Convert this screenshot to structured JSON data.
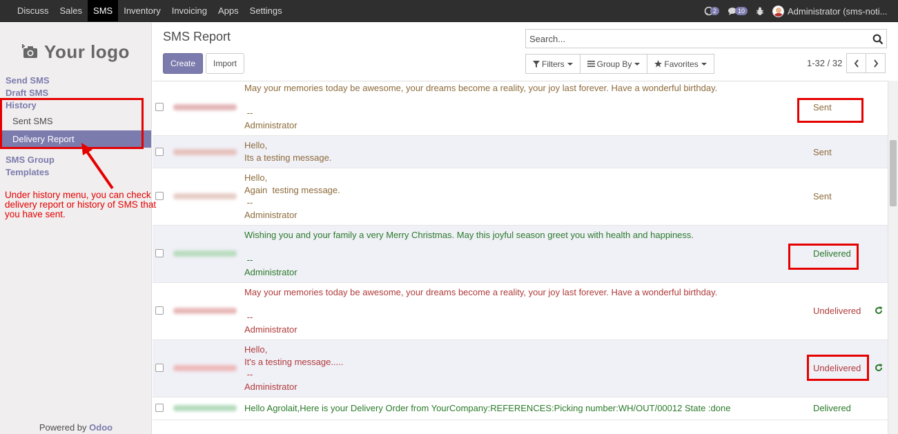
{
  "topbar": {
    "menu": [
      "Discuss",
      "Sales",
      "SMS",
      "Inventory",
      "Invoicing",
      "Apps",
      "Settings"
    ],
    "active_menu": "SMS",
    "chat_count": "2",
    "activity_count": "10",
    "user_label": "Administrator (sms-noti..."
  },
  "sidebar": {
    "logo_text": "Your logo",
    "send_sms": "Send SMS",
    "draft_sms": "Draft SMS",
    "history": "History",
    "sent_sms": "Sent SMS",
    "delivery_report": "Delivery Report",
    "sms_group": "SMS Group",
    "templates": "Templates",
    "annotation": "Under history menu, you can check delivery report or history of SMS that you have sent.",
    "powered_prefix": "Powered by ",
    "powered_brand": "Odoo"
  },
  "control_panel": {
    "title": "SMS Report",
    "create_label": "Create",
    "import_label": "Import",
    "search_placeholder": "Search...",
    "filters_label": "Filters",
    "groupby_label": "Group By",
    "favorites_label": "Favorites",
    "pager": "1-32 / 32"
  },
  "rows": [
    {
      "message": "May your memories today be awesome, your dreams become a reality, your joy last forever. Have a wonderful birthday.\n\n --\nAdministrator",
      "status": "Sent"
    },
    {
      "message": "Hello,\nIts a testing message.",
      "status": "Sent"
    },
    {
      "message": "Hello,\nAgain  testing message.\n --\nAdministrator",
      "status": "Sent"
    },
    {
      "message": "Wishing you and your family a very Merry Christmas. May this joyful season greet you with health and happiness.\n\n --\nAdministrator",
      "status": "Delivered"
    },
    {
      "message": "May your memories today be awesome, your dreams become a reality, your joy last forever. Have a wonderful birthday.\n\n --\nAdministrator",
      "status": "Undelivered"
    },
    {
      "message": "Hello,\nIt's a testing message.....\n --\nAdministrator",
      "status": "Undelivered"
    },
    {
      "message": "Hello Agrolait,Here is your Delivery Order from YourCompany:REFERENCES:Picking number:WH/OUT/00012 State :done",
      "status": "Delivered"
    }
  ],
  "colors": {
    "accent": "#7c7bad",
    "sent": "#8d6b3b",
    "delivered": "#2a7a2a",
    "undelivered": "#b03a3a",
    "annotation": "#e50000"
  }
}
